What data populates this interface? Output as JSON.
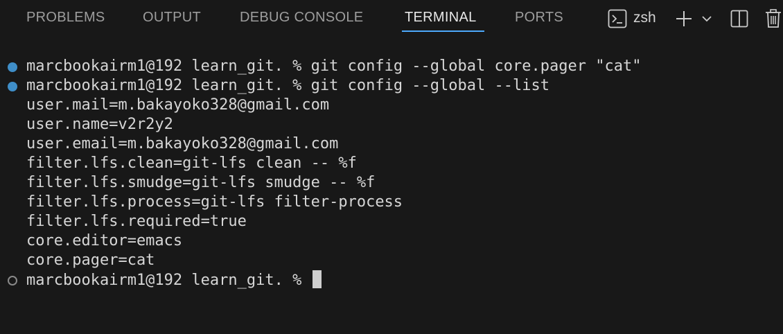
{
  "tabs": [
    {
      "label": "PROBLEMS"
    },
    {
      "label": "OUTPUT"
    },
    {
      "label": "DEBUG CONSOLE"
    },
    {
      "label": "TERMINAL"
    },
    {
      "label": "PORTS"
    }
  ],
  "actions": {
    "shell_name": "zsh",
    "icons": [
      "terminal-icon",
      "plus-icon",
      "chevron-down-icon",
      "split-icon",
      "trash-icon"
    ]
  },
  "terminal": {
    "prompt": "marcbookairm1@192 learn_git. % ",
    "commands": [
      "git config --global core.pager \"cat\"",
      "git config --global --list"
    ],
    "output": [
      "user.mail=m.bakayoko328@gmail.com",
      "user.name=v2r2y2",
      "user.email=m.bakayoko328@gmail.com",
      "filter.lfs.clean=git-lfs clean -- %f",
      "filter.lfs.smudge=git-lfs smudge -- %f",
      "filter.lfs.process=git-lfs filter-process",
      "filter.lfs.required=true",
      "core.editor=emacs",
      "core.pager=cat"
    ],
    "current_prompt": "marcbookairm1@192 learn_git. % "
  },
  "colors": {
    "background": "#181818",
    "active_tab": "#e7e7e7",
    "inactive_tab": "#9d9d9d",
    "tab_underline": "#4daafc",
    "success_decoration": "#3f8ec8",
    "idle_decoration": "#8a8a8a",
    "terminal_text": "#d6d6d6"
  }
}
